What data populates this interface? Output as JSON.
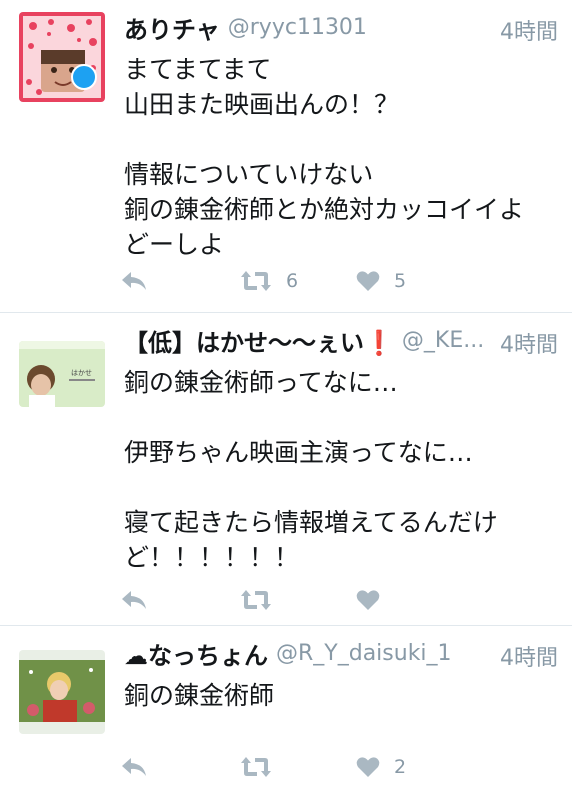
{
  "tweets": [
    {
      "name": "ありチャ",
      "handle": "@ryyc11301",
      "time": "4時間",
      "lines": [
        "まてまてまて",
        "山田また映画出んの！？",
        "",
        "情報についていけない",
        "銅の錬金術師とか絶対カッコイイよ",
        "どーしよ"
      ],
      "retweets": "6",
      "likes": "5",
      "verified_badge": true
    },
    {
      "name": "【低】はかせ〜〜ぇい❗",
      "handle": "@_KE...",
      "time": "4時間",
      "lines": [
        "銅の錬金術師ってなに…",
        "",
        "伊野ちゃん映画主演ってなに…",
        "",
        "寝て起きたら情報増えてるんだけ",
        "ど！！！！！！"
      ],
      "retweets": "",
      "likes": ""
    },
    {
      "name": "☁なっちょん",
      "handle": "@R_Y_daisuki_1",
      "time": "4時間",
      "lines": [
        "銅の錬金術師"
      ],
      "retweets": "",
      "likes": "2"
    }
  ],
  "icons": {
    "reply": "reply-icon",
    "retweet": "retweet-icon",
    "like": "heart-icon"
  },
  "colors": {
    "name": "#14171a",
    "meta": "#8899a6",
    "icon": "#aab8c2",
    "divider": "#e1e8ed",
    "verified": "#1da1f2"
  }
}
